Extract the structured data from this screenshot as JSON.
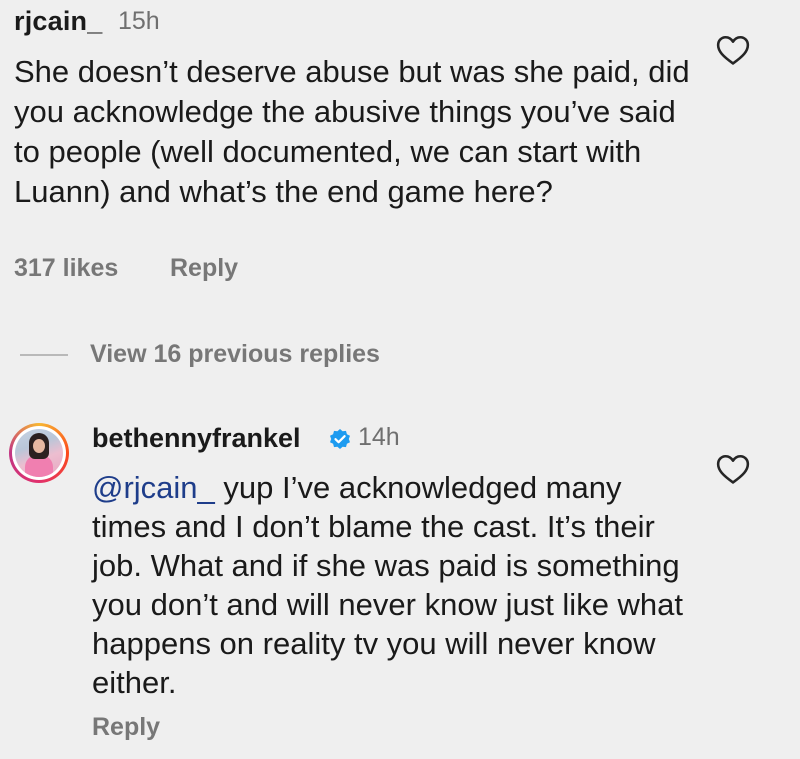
{
  "comments": [
    {
      "username": "rjcain_",
      "time": "15h",
      "text": "She doesn’t deserve abuse but was she paid, did you acknowledge the abusive things you’ve said to people (well documented, we can start with Luann) and what’s the end game here?",
      "likes": "317 likes",
      "reply_label": "Reply",
      "icon": "heart-outline-icon"
    },
    {
      "username": "bethennyfrankel",
      "verified": true,
      "time": "14h",
      "mention": "@rjcain_",
      "text": " yup I’ve acknowledged many times and I don’t blame the cast. It’s their job. What and if she was paid is something you don’t and will never know just like what happens on reality tv you will never know either.",
      "reply_label": "Reply",
      "icon": "heart-outline-icon"
    }
  ],
  "thread": {
    "view_replies_label": "View 16 previous replies"
  },
  "colors": {
    "background": "#efefef",
    "secondary_text": "#777777",
    "mention": "#1e3d8a",
    "verified": "#1d9bf0"
  }
}
